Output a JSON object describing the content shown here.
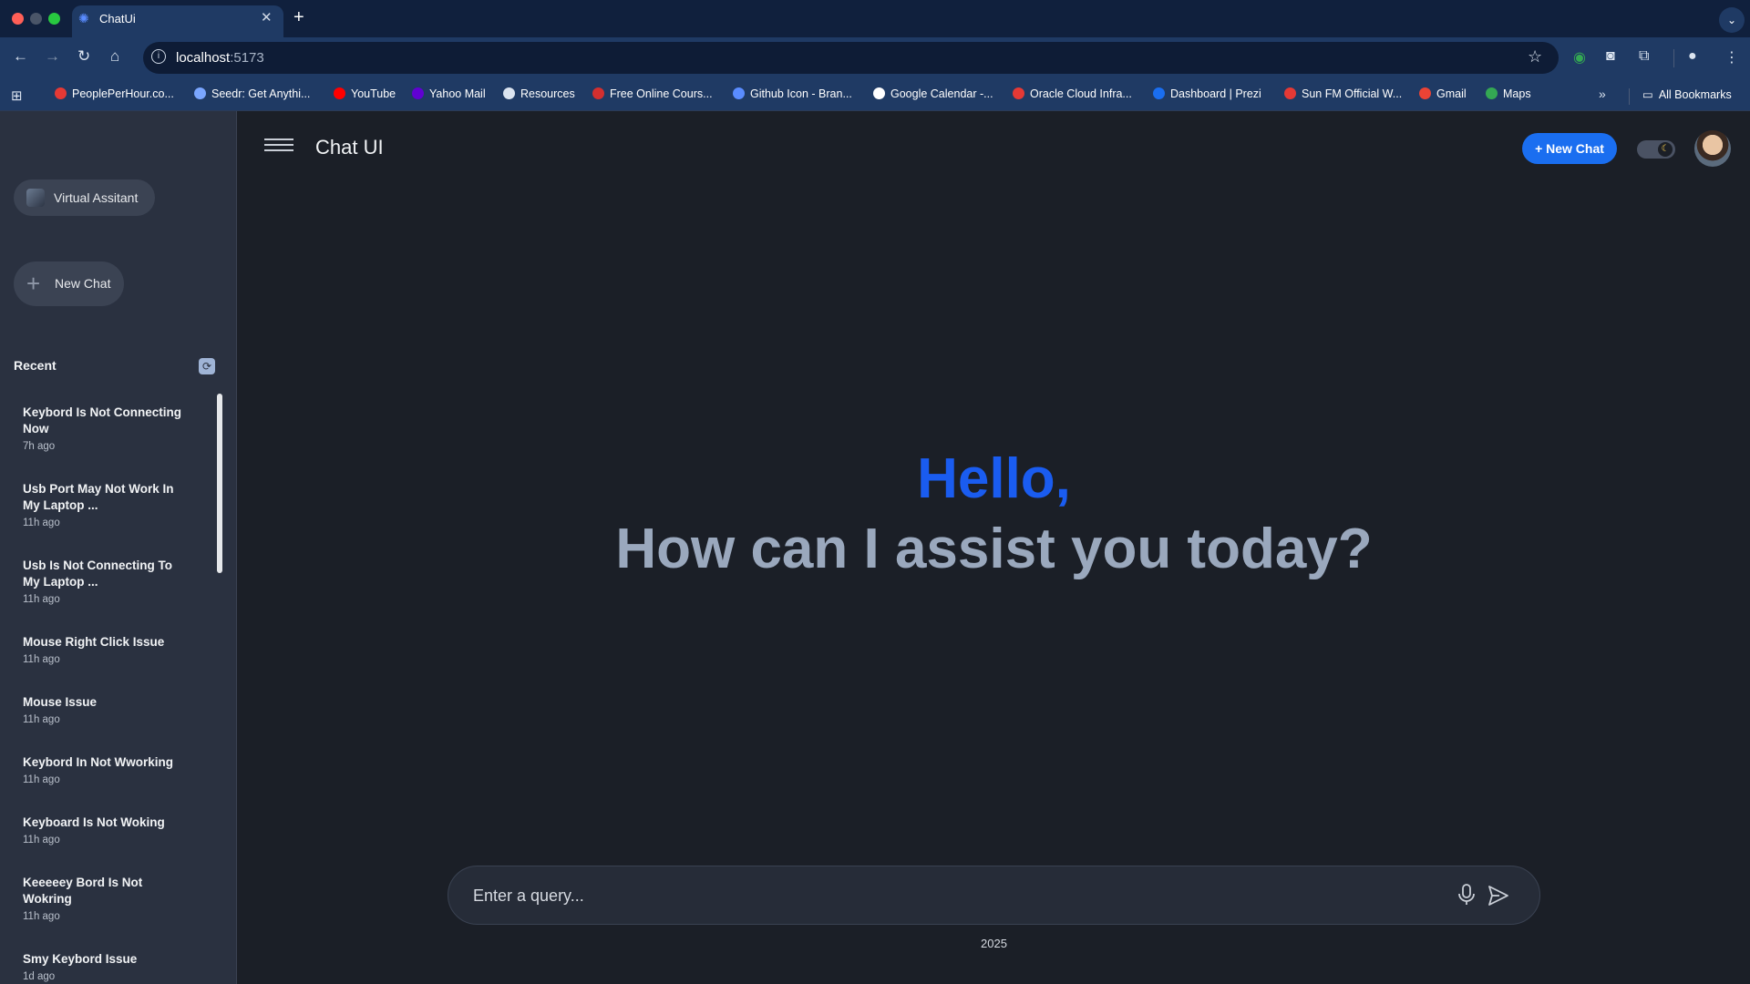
{
  "browser": {
    "tab_title": "ChatUi",
    "url_host": "localhost",
    "url_port": ":5173",
    "bookmarks": [
      {
        "label": "PeoplePerHour.co...",
        "color": "#e53935"
      },
      {
        "label": "Seedr: Get Anythi...",
        "color": "#7aa6ff"
      },
      {
        "label": "YouTube",
        "color": "#ff0000"
      },
      {
        "label": "Yahoo Mail",
        "color": "#6001d2"
      },
      {
        "label": "Resources",
        "color": "#dbe4f0"
      },
      {
        "label": "Free Online Cours...",
        "color": "#d32f2f"
      },
      {
        "label": "Github Icon - Bran...",
        "color": "#5a8cff"
      },
      {
        "label": "Google Calendar -...",
        "color": "#ffffff"
      },
      {
        "label": "Oracle Cloud Infra...",
        "color": "#e53935"
      },
      {
        "label": "Dashboard | Prezi",
        "color": "#1a6ef0"
      },
      {
        "label": "Sun FM Official W...",
        "color": "#e53935"
      },
      {
        "label": "Gmail",
        "color": "#ea4335"
      },
      {
        "label": "Maps",
        "color": "#34a853"
      }
    ],
    "all_bookmarks": "All Bookmarks"
  },
  "sidebar": {
    "assistant_label": "Virtual Assitant",
    "new_chat_label": "New Chat",
    "recent_label": "Recent",
    "history": [
      {
        "title": "Keybord Is Not Connecting Now",
        "time": "7h ago"
      },
      {
        "title": "Usb Port May Not Work In My Laptop ...",
        "time": "11h ago"
      },
      {
        "title": "Usb Is Not Connecting To My Laptop ...",
        "time": "11h ago"
      },
      {
        "title": "Mouse Right Click Issue",
        "time": "11h ago"
      },
      {
        "title": "Mouse Issue",
        "time": "11h ago"
      },
      {
        "title": "Keybord In Not Wworking",
        "time": "11h ago"
      },
      {
        "title": "Keyboard Is Not Woking",
        "time": "11h ago"
      },
      {
        "title": "Keeeeey Bord Is Not Wokring",
        "time": "11h ago"
      },
      {
        "title": "Smy Keybord Issue",
        "time": "1d ago"
      }
    ]
  },
  "header": {
    "title": "Chat UI",
    "new_chat_button": "+ New Chat"
  },
  "main": {
    "greeting": "Hello,",
    "subtitle": "How can I assist you today?",
    "query_placeholder": "Enter a query...",
    "footer_year": "2025"
  },
  "colors": {
    "accent": "#1a6ef0",
    "greeting": "#1a5cf0",
    "subtitle": "#9aa8bd"
  }
}
